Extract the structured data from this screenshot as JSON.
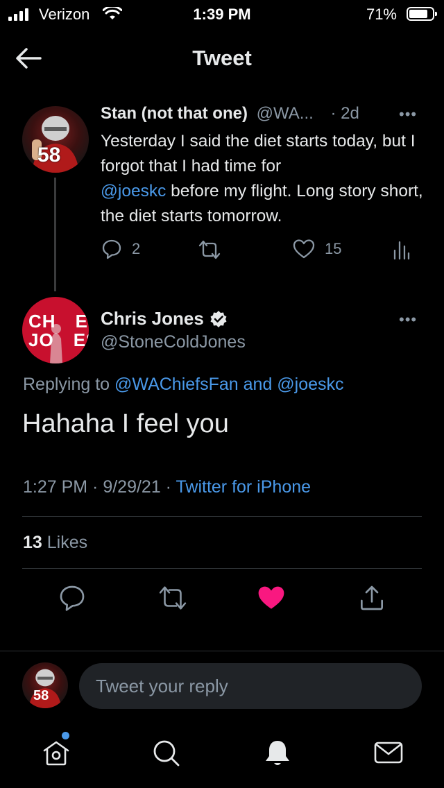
{
  "status_bar": {
    "carrier": "Verizon",
    "time": "1:39 PM",
    "battery": "71%",
    "battery_level": 0.71
  },
  "header": {
    "title": "Tweet",
    "back_icon": "arrow-left-icon"
  },
  "parent_tweet": {
    "name": "Stan (not that one)",
    "handle": "@WA...",
    "age": "· 2d",
    "text_part1": "Yesterday I said the diet starts today, but I forgot that I had time for",
    "mention": "@joeskc",
    "text_part2": " before my flight. Long story short, the diet starts tomorrow.",
    "replies": "2",
    "likes": "15",
    "avatar_jersey": "58"
  },
  "main_tweet": {
    "name": "Chris Jones",
    "handle": "@StoneColdJones",
    "verified": true,
    "replying_prefix": "Replying to ",
    "replying_to": "@WAChiefsFan and @joeskc",
    "text": "Hahaha I feel you",
    "timestamp": "1:27 PM · 9/29/21 · ",
    "source": "Twitter for iPhone",
    "likes_count": "13",
    "likes_label": "Likes",
    "liked": true,
    "avatar_text": [
      "CH",
      "JO",
      "ES",
      "ES"
    ]
  },
  "reply_bar": {
    "placeholder": "Tweet your reply",
    "avatar_jersey": "58"
  },
  "tab_bar": {
    "items": [
      "home-icon",
      "search-icon",
      "notifications-icon",
      "messages-icon"
    ],
    "home_has_dot": true
  },
  "colors": {
    "background": "#000000",
    "link": "#4a99e9",
    "muted": "#8b98a5",
    "like": "#f91880",
    "reply_box": "#202327"
  }
}
